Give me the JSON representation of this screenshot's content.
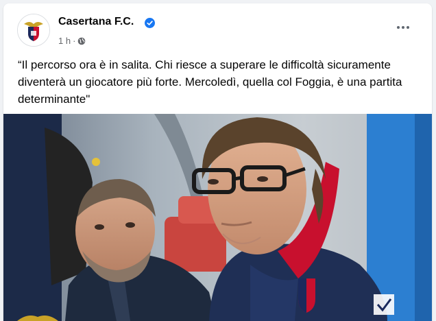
{
  "post": {
    "page_name": "Casertana F.C.",
    "time": "1 h",
    "separator": "·",
    "audience_icon": "globe-icon",
    "verified_icon": "verified-badge-icon",
    "text": "“Il percorso ora è in salita. Chi riesce a superare le difficoltà sicuramente diventerà un giocatore più forte. Mercoledì, quella col Foggia, è una partita determinante\"",
    "photo_description_icon": "post-photo"
  },
  "colors": {
    "verified": "#1877f2",
    "club_red": "#c8102e",
    "club_blue": "#1b2a5c"
  }
}
